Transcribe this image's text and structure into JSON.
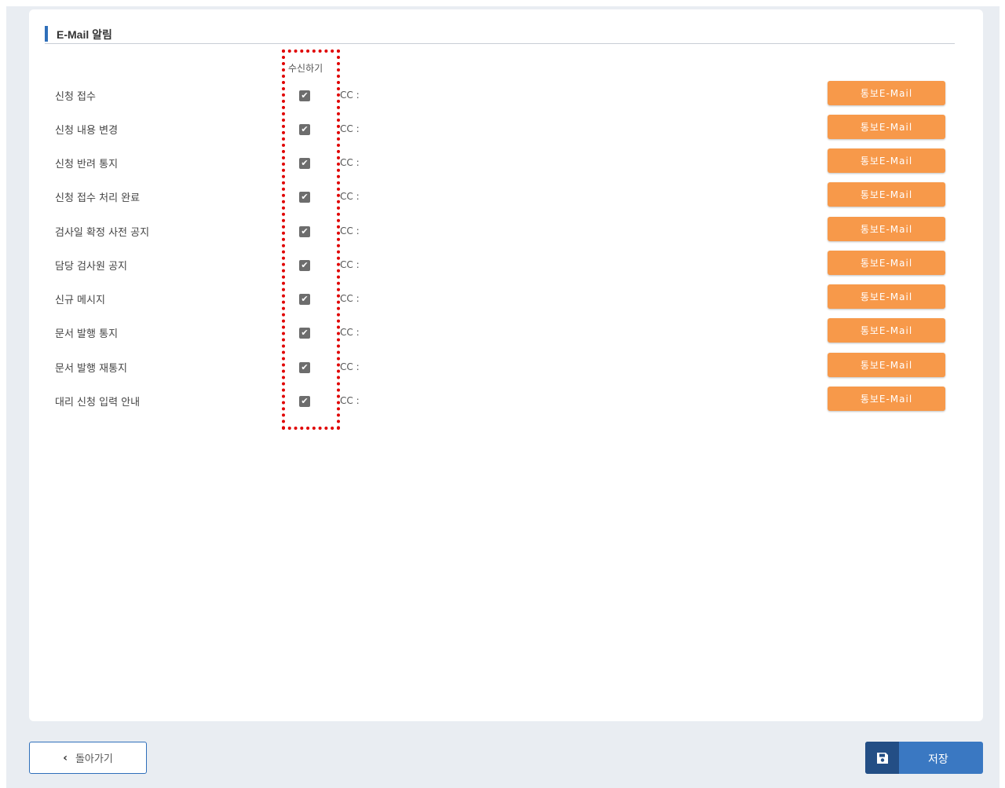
{
  "section": {
    "title": "E-Mail 알림"
  },
  "column_header": "수신하기",
  "cc_label": "CC :",
  "notify_button_label": "통보E-Mail",
  "rows": [
    {
      "label": "신청 접수",
      "checked": true
    },
    {
      "label": "신청 내용 변경",
      "checked": true
    },
    {
      "label": "신청 반려 통지",
      "checked": true
    },
    {
      "label": "신청 접수 처리 완료",
      "checked": true
    },
    {
      "label": "검사일 확정 사전 공지",
      "checked": true
    },
    {
      "label": "담당 검사원 공지",
      "checked": true
    },
    {
      "label": "신규 메시지",
      "checked": true
    },
    {
      "label": "문서 발행 통지",
      "checked": true
    },
    {
      "label": "문서 발행 재통지",
      "checked": true
    },
    {
      "label": "대리 신청 입력 안내",
      "checked": true
    }
  ],
  "footer": {
    "back_label": "돌아가기",
    "save_label": "저장"
  },
  "colors": {
    "accent": "#2f6fba",
    "notify_button": "#f7994a",
    "highlight_box": "#e00000"
  }
}
